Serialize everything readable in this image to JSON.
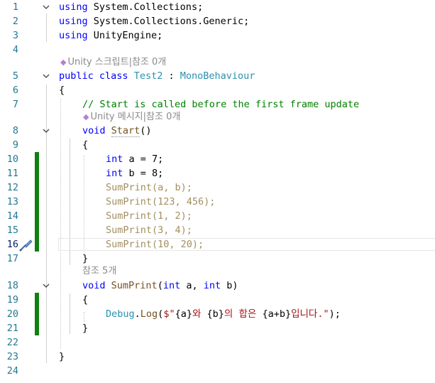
{
  "editor": {
    "line_numbers": [
      "1",
      "2",
      "3",
      "4",
      "5",
      "6",
      "7",
      "8",
      "9",
      "10",
      "11",
      "12",
      "13",
      "14",
      "15",
      "16",
      "17",
      "18",
      "19",
      "20",
      "21",
      "22",
      "23",
      "24"
    ],
    "current_line": "16",
    "lenses": {
      "class_refs": "Unity 스크립트|참조 0개",
      "start_refs": "Unity 메시지|참조 0개",
      "sumprint_refs": "참조 5개"
    },
    "code": {
      "l1": {
        "kw": "using",
        "rest": " System.Collections;"
      },
      "l2": {
        "kw": "using",
        "rest": " System.Collections.Generic;"
      },
      "l3": {
        "kw": "using",
        "rest": " UnityEngine;"
      },
      "l5": {
        "kw1": "public",
        "kw2": "class",
        "class_name": "Test2",
        "colon": " : ",
        "base": "MonoBehaviour"
      },
      "l6": "{",
      "l7": "// Start is called before the first frame update",
      "l8": {
        "kw": "void",
        "name": "Start",
        "parens": "()"
      },
      "l9": "{",
      "l10": {
        "kw": "int",
        "rest": " a = 7;"
      },
      "l11": {
        "kw": "int",
        "rest": " b = 8;"
      },
      "l12": {
        "name": "SumPrint",
        "args": "(a, b);"
      },
      "l13": {
        "name": "SumPrint",
        "args": "(123, 456);"
      },
      "l14": {
        "name": "SumPrint",
        "args": "(1, 2);"
      },
      "l15": {
        "name": "SumPrint",
        "args": "(3, 4);"
      },
      "l16": {
        "name": "SumPrint",
        "args": "(10, 20);"
      },
      "l17": "}",
      "l18": {
        "kw": "void",
        "name": "SumPrint",
        "p1": "(",
        "kw_int1": "int",
        "a": " a, ",
        "kw_int2": "int",
        "b": " b)"
      },
      "l19": "{",
      "l20": {
        "cls": "Debug",
        "dot": ".",
        "method": "Log",
        "open": "(",
        "str_start": "$\"",
        "i1": "{a}",
        "s1": "와 ",
        "i2": "{b}",
        "s2": "의 합은 ",
        "i3": "{a+b}",
        "s3": "입니다.\"",
        "close": ");"
      },
      "l21": "}",
      "l23": "}"
    },
    "colors": {
      "keyword": "#0000ff",
      "type": "#2b91af",
      "comment": "#008000",
      "change_bar": "#108010"
    },
    "icons": {
      "fold": "chevron-down-icon",
      "unity": "unity-icon",
      "quick_action": "screwdriver-icon"
    }
  }
}
